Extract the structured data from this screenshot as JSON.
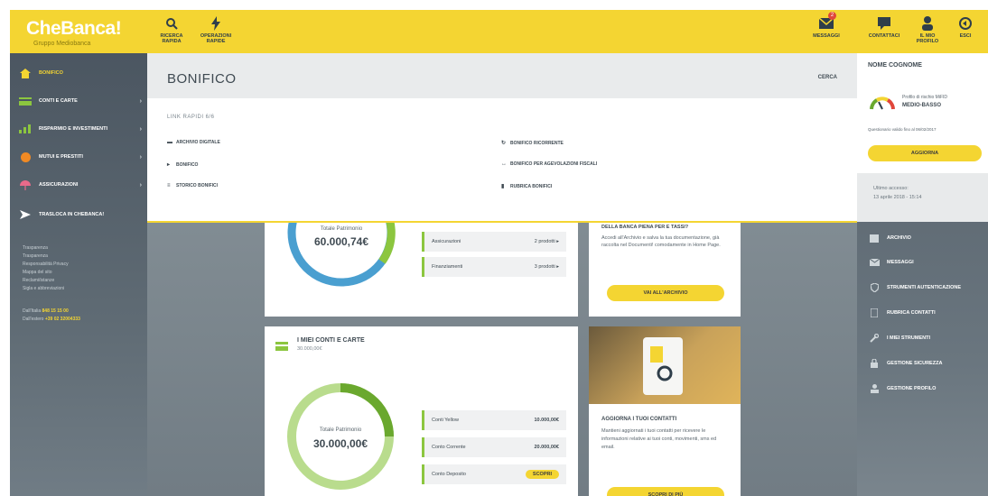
{
  "brand": {
    "name": "CheBanca!",
    "sub": "Gruppo Mediobanca"
  },
  "toolbar": [
    {
      "label": "RICERCA\nRAPIDA",
      "icon": "search-icon"
    },
    {
      "label": "OPERAZIONI\nRAPIDE",
      "icon": "lightning-icon"
    }
  ],
  "toolbar_right": [
    {
      "label": "MESSAGGI",
      "icon": "mail-icon",
      "badge": "2"
    },
    {
      "label": "CONTATTACI",
      "icon": "chat-icon"
    },
    {
      "label": "IL MIO\nPROFILO",
      "icon": "user-icon"
    },
    {
      "label": "ESCI",
      "icon": "logout-icon"
    }
  ],
  "sidebar": {
    "items": [
      {
        "label": "BONIFICO",
        "icon": "home-icon",
        "active": true
      },
      {
        "label": "CONTI E CARTE",
        "icon": "card-icon"
      },
      {
        "label": "RISPARMIO E INVESTIMENTI",
        "icon": "chart-icon"
      },
      {
        "label": "MUTUI E PRESTITI",
        "icon": "coin-icon"
      },
      {
        "label": "ASSICURAZIONI",
        "icon": "umbrella-icon"
      },
      {
        "label": "TRASLOCA IN CHEBANCA!",
        "icon": "arrow-icon"
      }
    ],
    "links": [
      "Trasparenza",
      "Trasparenza",
      "Responsabilità Privacy",
      "Mappa del sito",
      "Reclami/istanze",
      "Sigla e abbreviazioni"
    ],
    "phones": [
      {
        "prefix": "Dall'Italia",
        "number": "848 15 15 00"
      },
      {
        "prefix": "Dall'estero",
        "number": "+39 02 32004333"
      }
    ]
  },
  "overlay": {
    "title": "BONIFICO",
    "search": "CERCA",
    "subtitle": "LINK RAPIDI 6/6",
    "links_left": [
      {
        "label": "ARCHIVIO DIGITALE",
        "icon": "folder-icon"
      },
      {
        "label": "BONIFICO",
        "icon": "arrow-right-icon"
      },
      {
        "label": "STORICO BONIFICI",
        "icon": "list-icon"
      }
    ],
    "links_right": [
      {
        "label": "BONIFICO RICORRENTE",
        "icon": "repeat-icon"
      },
      {
        "label": "BONIFICO PER AGEVOLAZIONI FISCALI",
        "icon": "tax-icon"
      },
      {
        "label": "RUBRICA BONIFICI",
        "icon": "book-icon"
      }
    ]
  },
  "patrimonio": {
    "label": "Totale Patrimonio",
    "value": "60.000,74€",
    "rows": [
      {
        "label": "Assicurazioni",
        "value": "2 prodotti ▸"
      },
      {
        "label": "Finanziamenti",
        "value": "3 prodotti ▸"
      }
    ]
  },
  "archive_card": {
    "heading": "DELLA BANCA PIENA PER E TASSI?",
    "text": "Accedi all'Archivio e salva la tua documentazione, già raccolta nel Documenti! comodamente in Home Page.",
    "button": "VAI ALL'ARCHIVIO"
  },
  "conti": {
    "title": "I MIEI CONTI E CARTE",
    "amount": "30.000,00€",
    "label": "Totale Patrimonio",
    "value": "30.000,00€",
    "rows": [
      {
        "label": "Conti Yellow",
        "value": "10.000,00€"
      },
      {
        "label": "Conto Corrente",
        "value": "20.000,00€"
      },
      {
        "label": "Conto Deposito",
        "value": "SCOPRI"
      }
    ]
  },
  "contacts_card": {
    "heading": "AGGIORNA I TUOI CONTATTI",
    "text": "Mantieni aggiornati i tuoi contatti per ricevere le informazioni relative ai tuoi conti, movimenti, sms ed email.",
    "button": "SCOPRI DI PIÙ"
  },
  "profile": {
    "name": "NOME COGNOME",
    "risk_label": "Profilo di rischio MiFID",
    "risk_value": "MEDIO-BASSO",
    "valid": "Questionario valido fino al 06/02/2017",
    "button": "AGGIORNA",
    "access_label": "Ultimo accesso:",
    "access_value": "13 aprile 2018 - 15:14"
  },
  "right_menu": [
    {
      "label": "ARCHIVIO",
      "icon": "archive-icon"
    },
    {
      "label": "MESSAGGI",
      "icon": "envelope-icon"
    },
    {
      "label": "STRUMENTI AUTENTICAZIONE",
      "icon": "shield-icon"
    },
    {
      "label": "RUBRICA CONTATTI",
      "icon": "contacts-icon"
    },
    {
      "label": "I MIEI STRUMENTI",
      "icon": "wrench-icon"
    },
    {
      "label": "GESTIONE SICUREZZA",
      "icon": "lock-icon"
    },
    {
      "label": "GESTIONE PROFILO",
      "icon": "profile-icon"
    }
  ],
  "colors": {
    "brand": "#f4d532",
    "sidebar": "#4b5661",
    "green": "#8cc63f",
    "blue": "#4a9fd0"
  }
}
